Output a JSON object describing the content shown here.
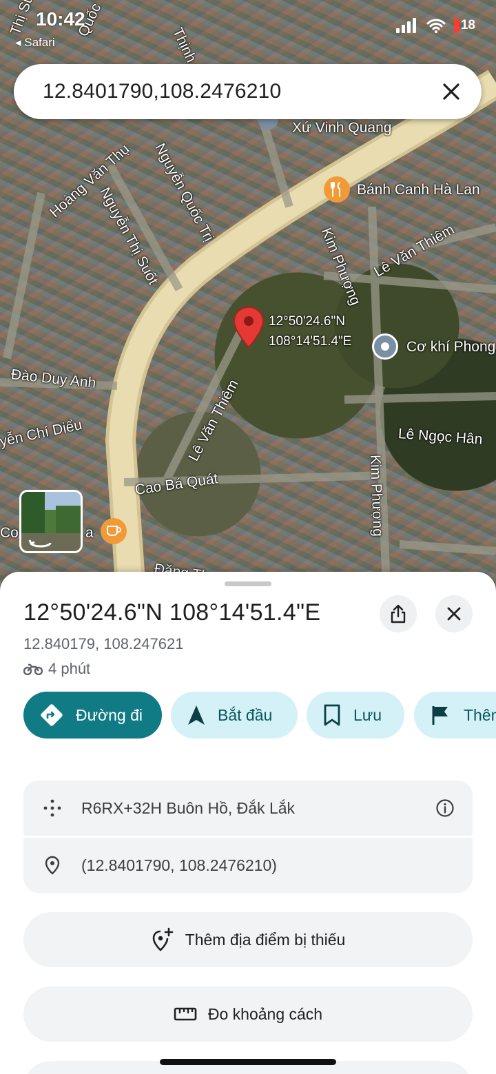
{
  "status_bar": {
    "time": "10:42",
    "back_app": "Safari",
    "battery": "18"
  },
  "search": {
    "query": "12.8401790,108.2476210"
  },
  "map": {
    "streets": [
      "Thị Suốt",
      "Quốc Trị",
      "Thịnh",
      "Hoàng Văn Thụ",
      "Nguyễn Thị Suốt",
      "Nguyễn Quốc Trị",
      "Kim Phượng",
      "Lê Văn Thiêm",
      "Đào Duy Anh",
      "yễn Chí Diểu",
      "Lê Văn Thiêm",
      "Cao Bá Quát",
      "Kim Phượng",
      "Lê Ngọc Hân",
      "Đặng Th"
    ],
    "pois": {
      "church": "Xứ Vinh Quang",
      "restaurant": "Bánh Canh Hà Lan",
      "workshop": "Cơ khí Phong",
      "cafe_left": "Co",
      "cafe_right": "a"
    },
    "pin_label_line1": "12°50'24.6\"N",
    "pin_label_line2": "108°14'51.4\"E",
    "colors": {
      "road": "#e8dcb0",
      "pin": "#e53935",
      "poi_food": "#f29a38",
      "poi_gray": "#7b8fa3"
    }
  },
  "sheet": {
    "title": "12°50'24.6\"N 108°14'51.4\"E",
    "decimal": "12.840179, 108.247621",
    "travel_time": "4 phút",
    "chips": {
      "directions": "Đường đi",
      "start": "Bắt đầu",
      "save": "Lưu",
      "more": "Thêm"
    },
    "plus_code": "R6RX+32H Buôn Hồ, Đắk Lắk",
    "coordinates": "(12.8401790, 108.2476210)",
    "add_missing": "Thêm địa điểm bị thiếu",
    "measure": "Đo khoảng cách",
    "colors": {
      "primary": "#107a85",
      "chip_light": "#d3f1f6",
      "card": "#f1f3f4"
    }
  }
}
